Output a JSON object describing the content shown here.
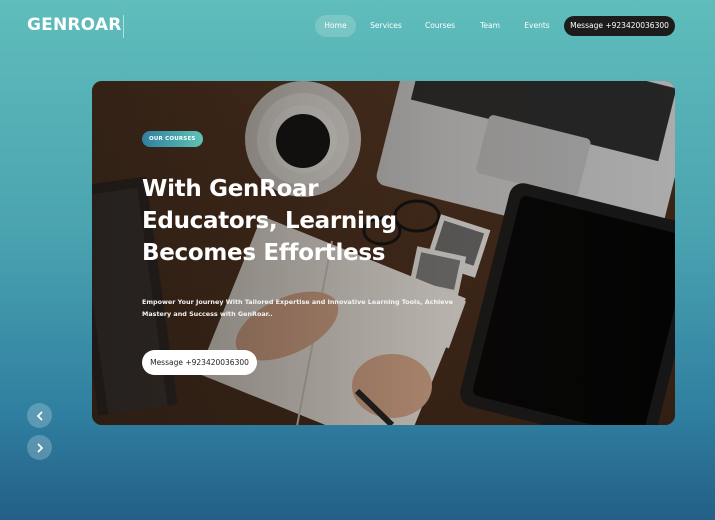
{
  "brand": {
    "logo": "GENROAR"
  },
  "nav": {
    "items": [
      {
        "label": "Home",
        "active": true
      },
      {
        "label": "Services",
        "active": false
      },
      {
        "label": "Courses",
        "active": false
      },
      {
        "label": "Team",
        "active": false
      },
      {
        "label": "Events",
        "active": false
      }
    ],
    "cta_label": "Message +923420036300"
  },
  "hero": {
    "badge": "OUR COURSES",
    "headline_line1": "With GenRoar",
    "headline_line2": "Educators, Learning",
    "headline_line3": "Becomes Effortless",
    "subtext": "Empower Your Journey With Tailored Expertise and Innovative Learning Tools, Achieve Mastery and Success with GenRoar..",
    "cta_label": "Message +923420036300"
  },
  "carousel": {
    "prev_icon": "chevron-left-icon",
    "next_icon": "chevron-right-icon"
  },
  "colors": {
    "accent_dark": "#1c1c1c",
    "badge_start": "#2f7fa0",
    "badge_end": "#5ec3b6"
  }
}
